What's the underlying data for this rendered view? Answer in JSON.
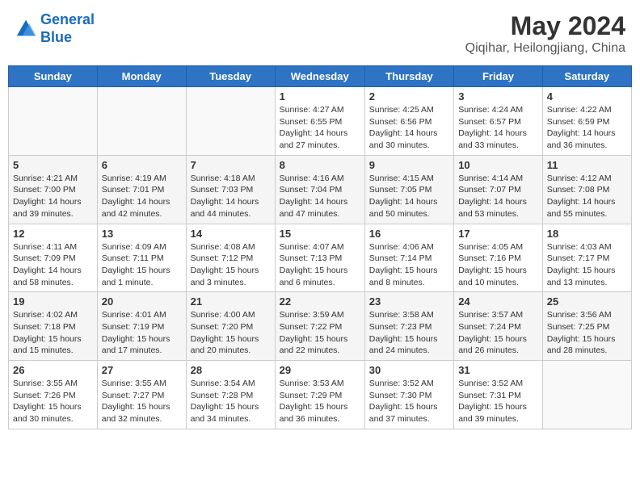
{
  "header": {
    "logo_line1": "General",
    "logo_line2": "Blue",
    "title": "May 2024",
    "subtitle": "Qiqihar, Heilongjiang, China"
  },
  "calendar": {
    "weekdays": [
      "Sunday",
      "Monday",
      "Tuesday",
      "Wednesday",
      "Thursday",
      "Friday",
      "Saturday"
    ],
    "weeks": [
      [
        {
          "day": "",
          "info": ""
        },
        {
          "day": "",
          "info": ""
        },
        {
          "day": "",
          "info": ""
        },
        {
          "day": "1",
          "info": "Sunrise: 4:27 AM\nSunset: 6:55 PM\nDaylight: 14 hours\nand 27 minutes."
        },
        {
          "day": "2",
          "info": "Sunrise: 4:25 AM\nSunset: 6:56 PM\nDaylight: 14 hours\nand 30 minutes."
        },
        {
          "day": "3",
          "info": "Sunrise: 4:24 AM\nSunset: 6:57 PM\nDaylight: 14 hours\nand 33 minutes."
        },
        {
          "day": "4",
          "info": "Sunrise: 4:22 AM\nSunset: 6:59 PM\nDaylight: 14 hours\nand 36 minutes."
        }
      ],
      [
        {
          "day": "5",
          "info": "Sunrise: 4:21 AM\nSunset: 7:00 PM\nDaylight: 14 hours\nand 39 minutes."
        },
        {
          "day": "6",
          "info": "Sunrise: 4:19 AM\nSunset: 7:01 PM\nDaylight: 14 hours\nand 42 minutes."
        },
        {
          "day": "7",
          "info": "Sunrise: 4:18 AM\nSunset: 7:03 PM\nDaylight: 14 hours\nand 44 minutes."
        },
        {
          "day": "8",
          "info": "Sunrise: 4:16 AM\nSunset: 7:04 PM\nDaylight: 14 hours\nand 47 minutes."
        },
        {
          "day": "9",
          "info": "Sunrise: 4:15 AM\nSunset: 7:05 PM\nDaylight: 14 hours\nand 50 minutes."
        },
        {
          "day": "10",
          "info": "Sunrise: 4:14 AM\nSunset: 7:07 PM\nDaylight: 14 hours\nand 53 minutes."
        },
        {
          "day": "11",
          "info": "Sunrise: 4:12 AM\nSunset: 7:08 PM\nDaylight: 14 hours\nand 55 minutes."
        }
      ],
      [
        {
          "day": "12",
          "info": "Sunrise: 4:11 AM\nSunset: 7:09 PM\nDaylight: 14 hours\nand 58 minutes."
        },
        {
          "day": "13",
          "info": "Sunrise: 4:09 AM\nSunset: 7:11 PM\nDaylight: 15 hours\nand 1 minute."
        },
        {
          "day": "14",
          "info": "Sunrise: 4:08 AM\nSunset: 7:12 PM\nDaylight: 15 hours\nand 3 minutes."
        },
        {
          "day": "15",
          "info": "Sunrise: 4:07 AM\nSunset: 7:13 PM\nDaylight: 15 hours\nand 6 minutes."
        },
        {
          "day": "16",
          "info": "Sunrise: 4:06 AM\nSunset: 7:14 PM\nDaylight: 15 hours\nand 8 minutes."
        },
        {
          "day": "17",
          "info": "Sunrise: 4:05 AM\nSunset: 7:16 PM\nDaylight: 15 hours\nand 10 minutes."
        },
        {
          "day": "18",
          "info": "Sunrise: 4:03 AM\nSunset: 7:17 PM\nDaylight: 15 hours\nand 13 minutes."
        }
      ],
      [
        {
          "day": "19",
          "info": "Sunrise: 4:02 AM\nSunset: 7:18 PM\nDaylight: 15 hours\nand 15 minutes."
        },
        {
          "day": "20",
          "info": "Sunrise: 4:01 AM\nSunset: 7:19 PM\nDaylight: 15 hours\nand 17 minutes."
        },
        {
          "day": "21",
          "info": "Sunrise: 4:00 AM\nSunset: 7:20 PM\nDaylight: 15 hours\nand 20 minutes."
        },
        {
          "day": "22",
          "info": "Sunrise: 3:59 AM\nSunset: 7:22 PM\nDaylight: 15 hours\nand 22 minutes."
        },
        {
          "day": "23",
          "info": "Sunrise: 3:58 AM\nSunset: 7:23 PM\nDaylight: 15 hours\nand 24 minutes."
        },
        {
          "day": "24",
          "info": "Sunrise: 3:57 AM\nSunset: 7:24 PM\nDaylight: 15 hours\nand 26 minutes."
        },
        {
          "day": "25",
          "info": "Sunrise: 3:56 AM\nSunset: 7:25 PM\nDaylight: 15 hours\nand 28 minutes."
        }
      ],
      [
        {
          "day": "26",
          "info": "Sunrise: 3:55 AM\nSunset: 7:26 PM\nDaylight: 15 hours\nand 30 minutes."
        },
        {
          "day": "27",
          "info": "Sunrise: 3:55 AM\nSunset: 7:27 PM\nDaylight: 15 hours\nand 32 minutes."
        },
        {
          "day": "28",
          "info": "Sunrise: 3:54 AM\nSunset: 7:28 PM\nDaylight: 15 hours\nand 34 minutes."
        },
        {
          "day": "29",
          "info": "Sunrise: 3:53 AM\nSunset: 7:29 PM\nDaylight: 15 hours\nand 36 minutes."
        },
        {
          "day": "30",
          "info": "Sunrise: 3:52 AM\nSunset: 7:30 PM\nDaylight: 15 hours\nand 37 minutes."
        },
        {
          "day": "31",
          "info": "Sunrise: 3:52 AM\nSunset: 7:31 PM\nDaylight: 15 hours\nand 39 minutes."
        },
        {
          "day": "",
          "info": ""
        }
      ]
    ]
  }
}
